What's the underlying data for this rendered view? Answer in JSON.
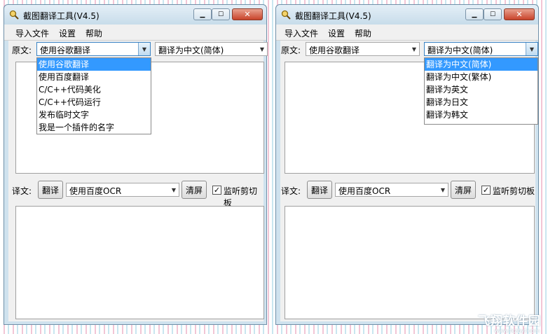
{
  "windows": [
    {
      "title": "截图翻译工具(V4.5)",
      "menu": [
        "导入文件",
        "设置",
        "帮助"
      ],
      "source_label": "原文:",
      "engine_select": "使用谷歌翻译",
      "target_select": "翻译为中文(简体)",
      "translation_label": "译文:",
      "translate_button": "翻译",
      "ocr_select": "使用百度OCR",
      "clear_button": "清屏",
      "clipboard_check": "✓",
      "clipboard_label": "监听剪切板",
      "dropdown": [
        "使用谷歌翻译",
        "使用百度翻译",
        "C/C++代码美化",
        "C/C++代码运行",
        "发布临时文字",
        "我是一个插件的名字"
      ]
    },
    {
      "title": "截图翻译工具(V4.5)",
      "menu": [
        "导入文件",
        "设置",
        "帮助"
      ],
      "source_label": "原文:",
      "engine_select": "使用谷歌翻译",
      "target_select": "翻译为中文(简体)",
      "translation_label": "译文:",
      "translate_button": "翻译",
      "ocr_select": "使用百度OCR",
      "clear_button": "清屏",
      "clipboard_check": "✓",
      "clipboard_label": "监听剪切板",
      "dropdown": [
        "翻译为中文(简体)",
        "翻译为中文(繁体)",
        "翻译为英文",
        "翻译为日文",
        "翻译为韩文"
      ]
    }
  ],
  "watermark": {
    "main": "飞翔软件园",
    "sub": "www.fxzbyf.com"
  },
  "colors": {
    "selection": "#3399ff",
    "window_frame": "#cfe2ee",
    "close_button": "#c8432a"
  },
  "icons": {
    "app": "magnifier-icon",
    "minimize": "minimize-icon",
    "maximize": "maximize-icon",
    "close": "close-icon",
    "dropdown": "chevron-down-icon"
  }
}
